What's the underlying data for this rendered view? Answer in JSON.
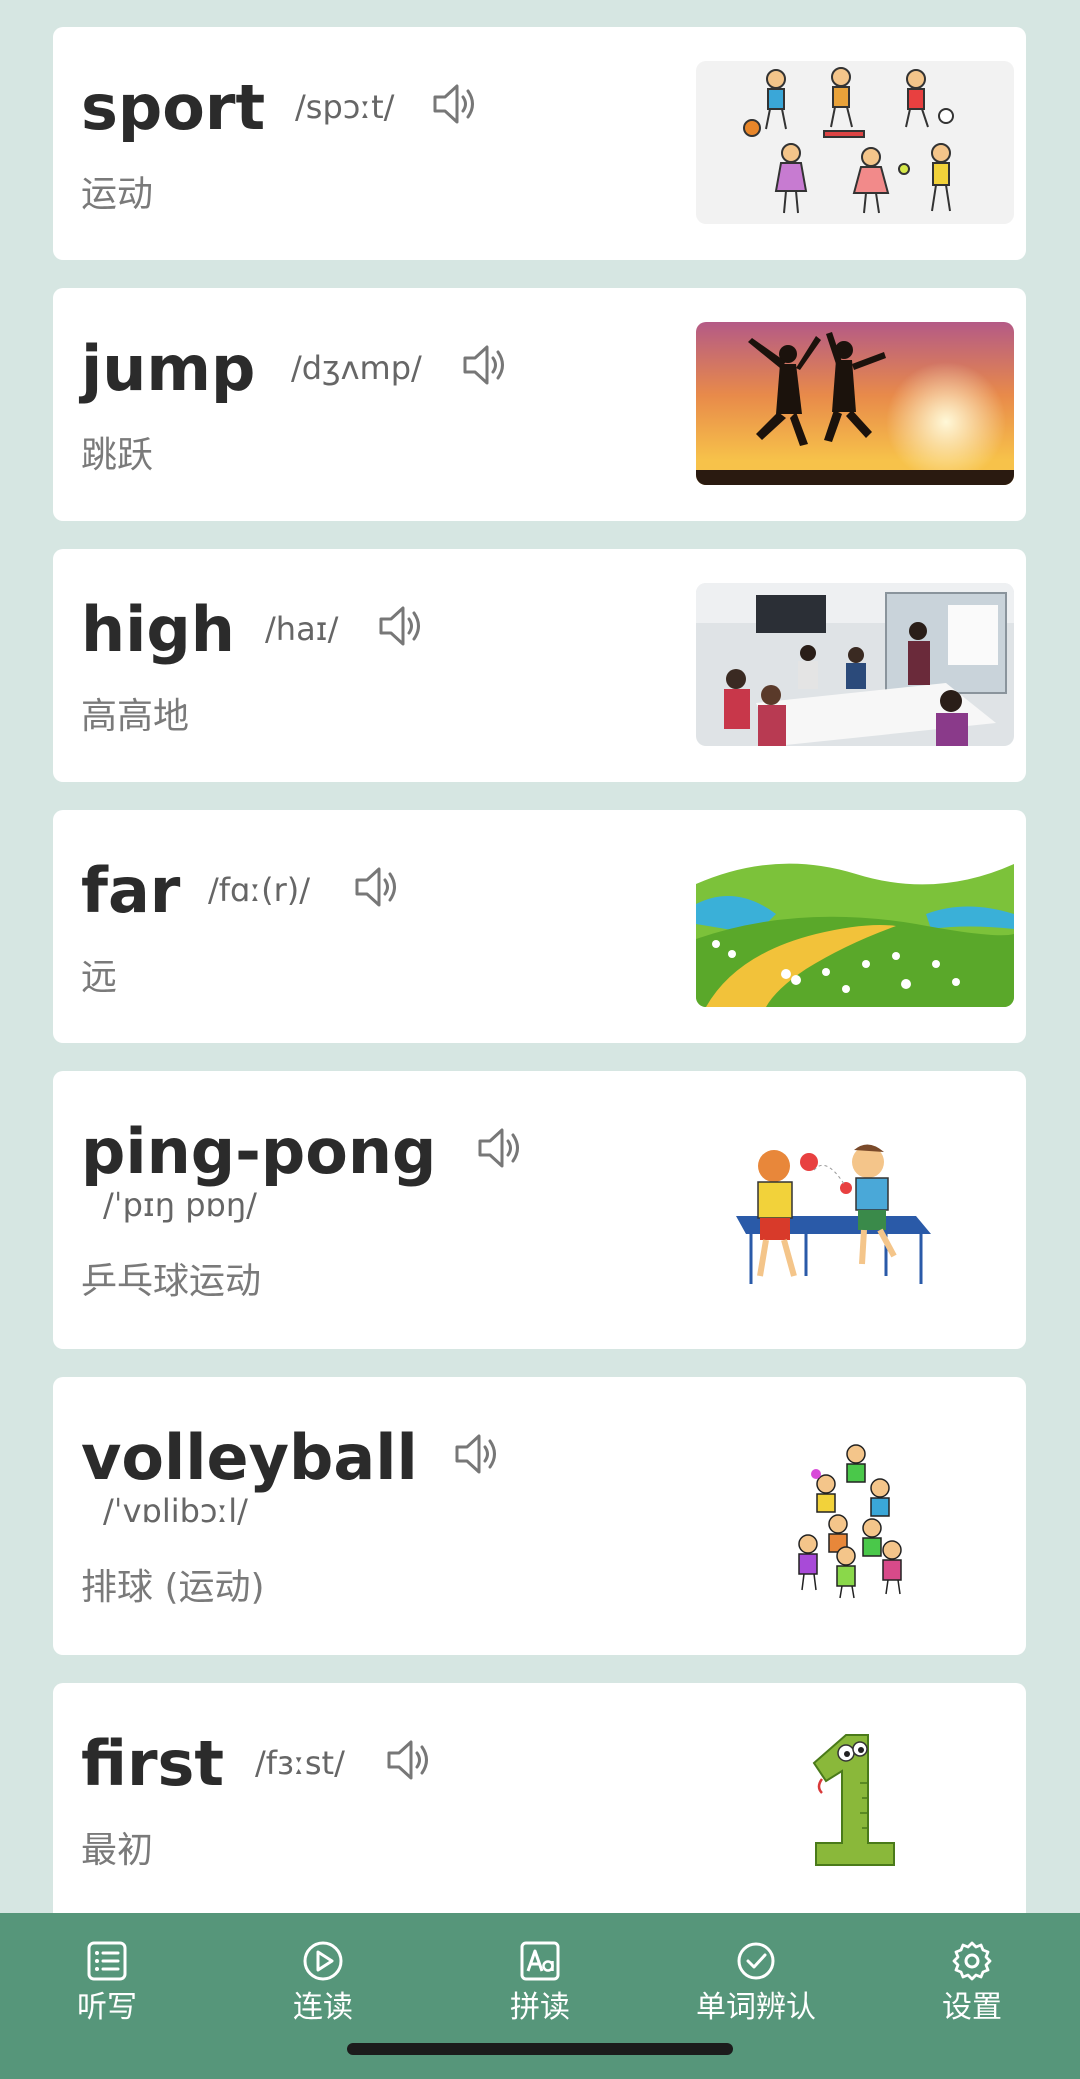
{
  "words": [
    {
      "word": "sport",
      "phonetic": "/spɔːt/",
      "meaning": "运动"
    },
    {
      "word": "jump",
      "phonetic": "/dʒʌmp/",
      "meaning": "跳跃"
    },
    {
      "word": "high",
      "phonetic": "/haɪ/",
      "meaning": "高高地"
    },
    {
      "word": "far",
      "phonetic": "/fɑː(r)/",
      "meaning": "远"
    },
    {
      "word": "ping-pong",
      "phonetic": "/ˈpɪŋ pɒŋ/",
      "meaning": "乒乓球运动"
    },
    {
      "word": "volleyball",
      "phonetic": "/ˈvɒlibɔːl/",
      "meaning": "排球 (运动)"
    },
    {
      "word": "first",
      "phonetic": "/fɜːst/",
      "meaning": "最初"
    }
  ],
  "speaker_icon": "speaker-icon",
  "tabs": [
    {
      "label": "听写",
      "icon": "list-icon"
    },
    {
      "label": "连读",
      "icon": "play-circle-icon"
    },
    {
      "label": "拼读",
      "icon": "spell-icon"
    },
    {
      "label": "单词辨认",
      "icon": "check-circle-icon"
    },
    {
      "label": "设置",
      "icon": "gear-icon"
    }
  ],
  "colors": {
    "background": "#d6e6e2",
    "tabbar": "#56967a",
    "card": "#ffffff",
    "word_text": "#2b2b2b",
    "meaning_text": "#7a7a7a"
  }
}
